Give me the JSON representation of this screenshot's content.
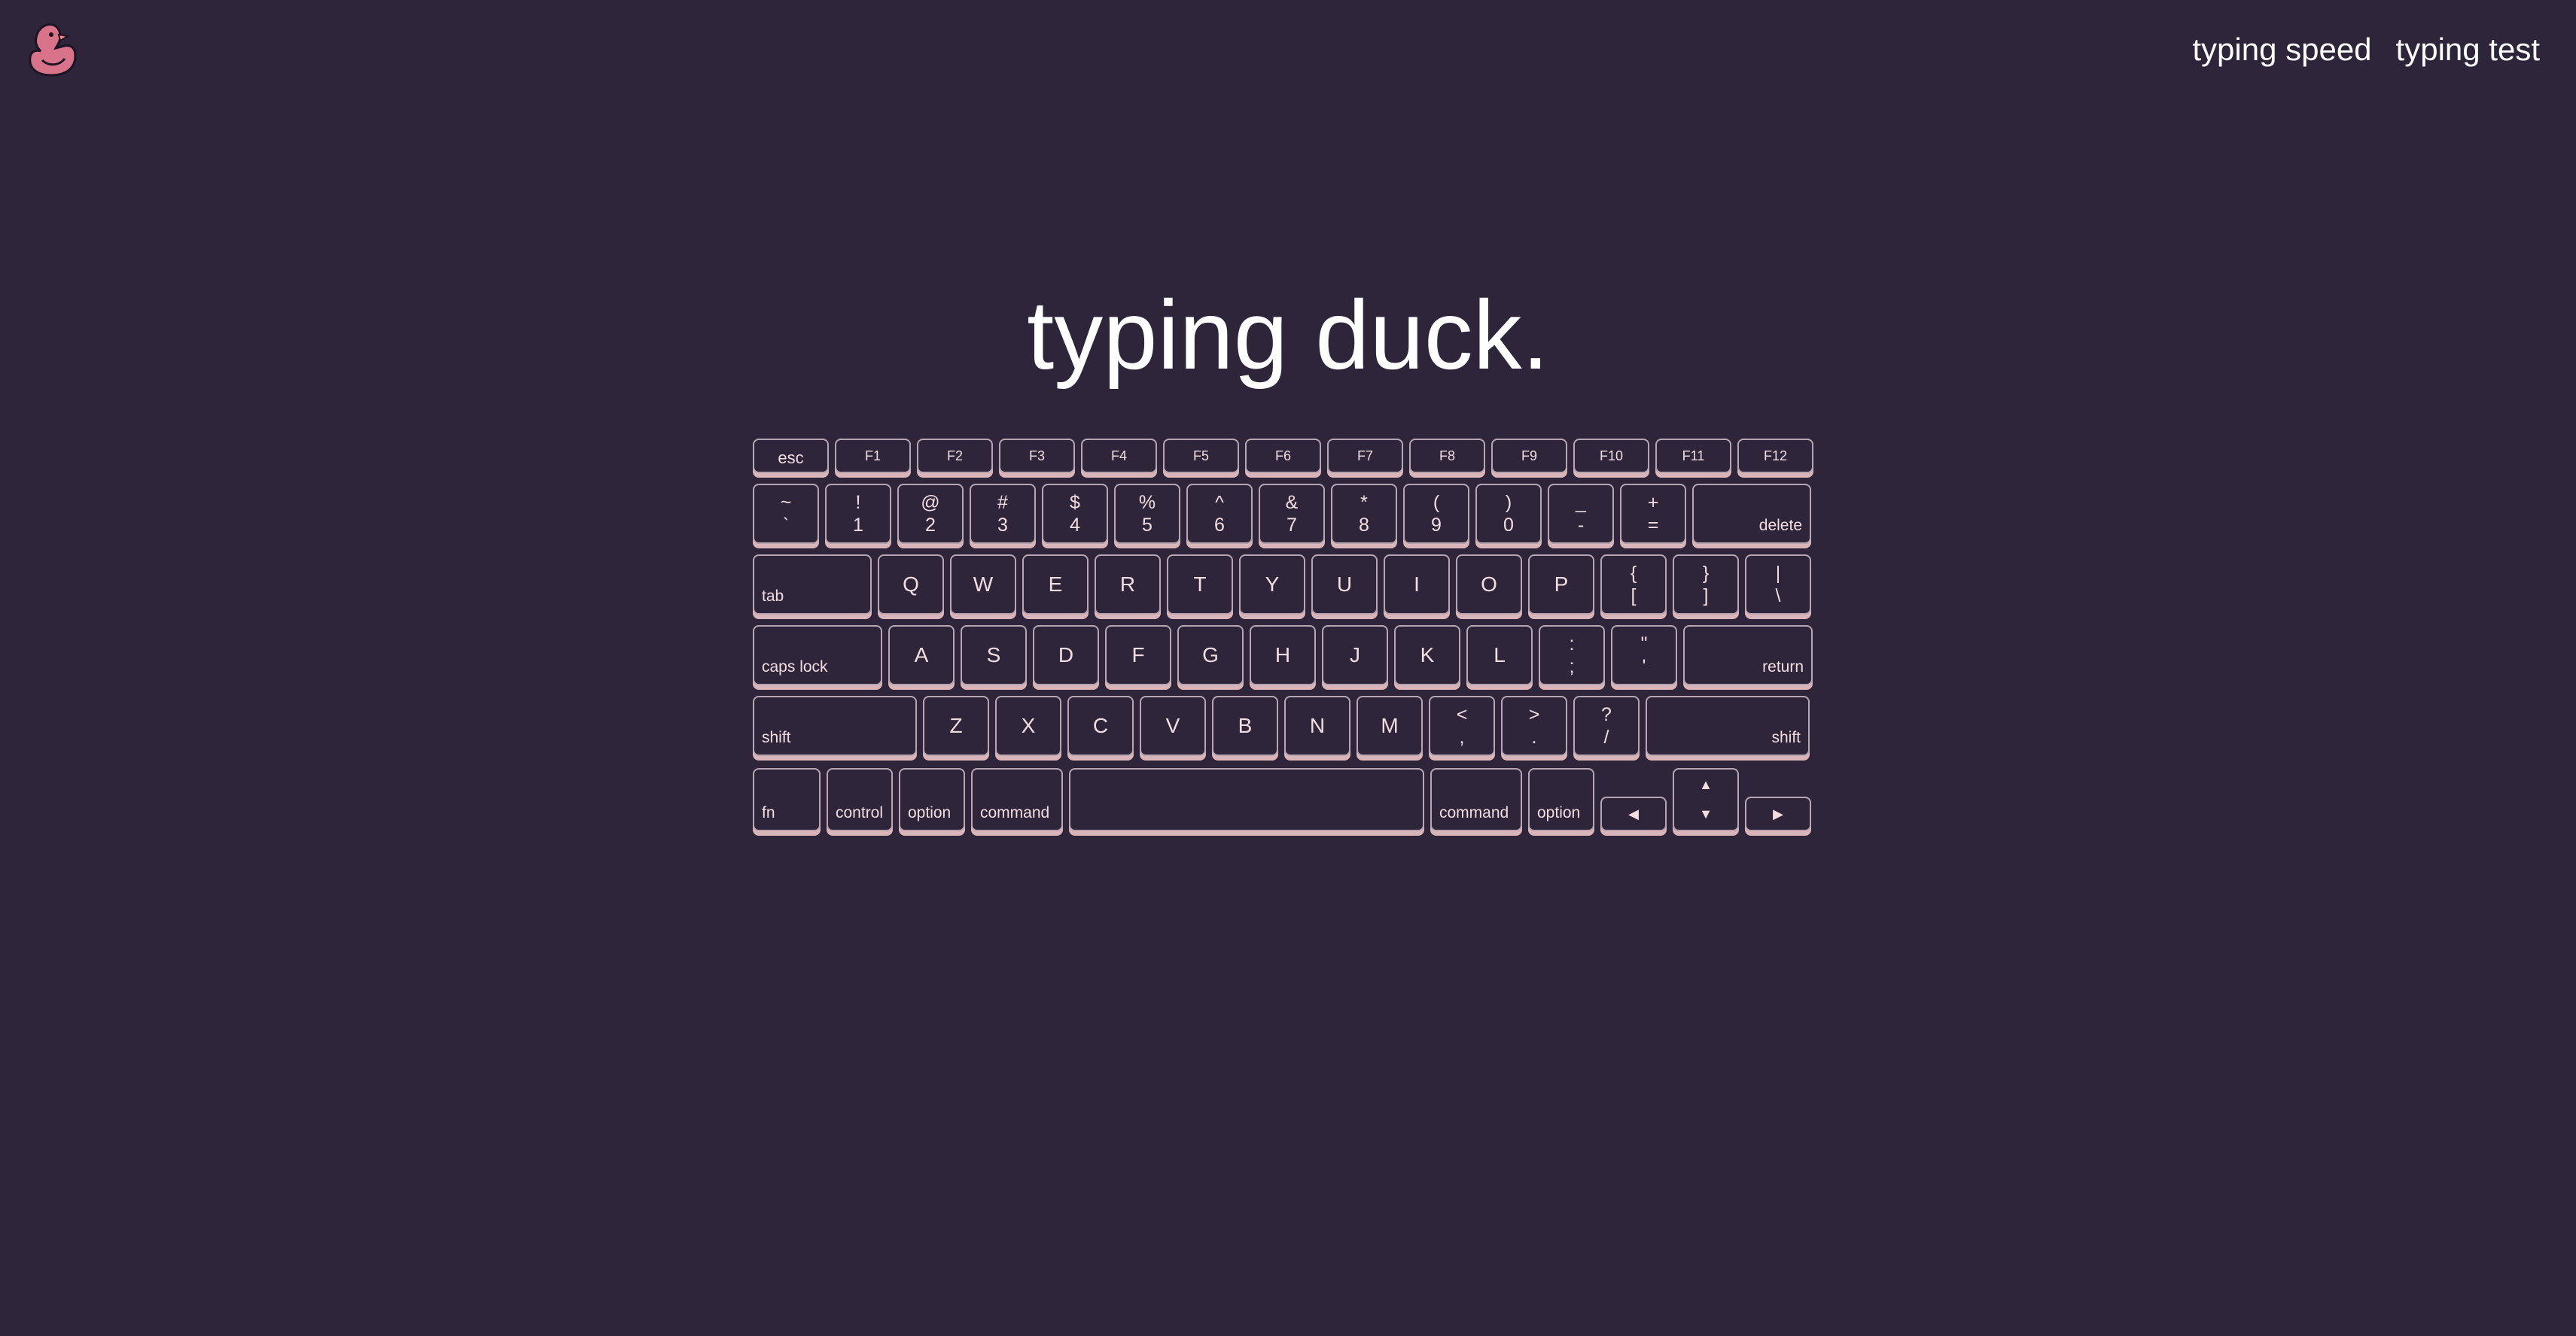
{
  "nav": {
    "speed": "typing speed",
    "test": "typing test"
  },
  "title": "typing duck.",
  "colors": {
    "background": "#2e253a",
    "key_border": "#b7a6b2",
    "key_shadow": "#d9b4b8",
    "key_text": "#f3dde0",
    "duck": "#d9738a"
  },
  "keyboard": {
    "fn_row": [
      "esc",
      "F1",
      "F2",
      "F3",
      "F4",
      "F5",
      "F6",
      "F7",
      "F8",
      "F9",
      "F10",
      "F11",
      "F12"
    ],
    "num_row": [
      {
        "top": "~",
        "bottom": "`"
      },
      {
        "top": "!",
        "bottom": "1"
      },
      {
        "top": "@",
        "bottom": "2"
      },
      {
        "top": "#",
        "bottom": "3"
      },
      {
        "top": "$",
        "bottom": "4"
      },
      {
        "top": "%",
        "bottom": "5"
      },
      {
        "top": "^",
        "bottom": "6"
      },
      {
        "top": "&",
        "bottom": "7"
      },
      {
        "top": "*",
        "bottom": "8"
      },
      {
        "top": "(",
        "bottom": "9"
      },
      {
        "top": ")",
        "bottom": "0"
      },
      {
        "top": "_",
        "bottom": "-"
      },
      {
        "top": "+",
        "bottom": "="
      }
    ],
    "delete": "delete",
    "tab": "tab",
    "qwerty": [
      "Q",
      "W",
      "E",
      "R",
      "T",
      "Y",
      "U",
      "I",
      "O",
      "P"
    ],
    "brackets": [
      {
        "top": "{",
        "bottom": "["
      },
      {
        "top": "}",
        "bottom": "]"
      },
      {
        "top": "|",
        "bottom": "\\"
      }
    ],
    "caps_lock": "caps lock",
    "home": [
      "A",
      "S",
      "D",
      "F",
      "G",
      "H",
      "J",
      "K",
      "L"
    ],
    "home_punct": [
      {
        "top": ":",
        "bottom": ";"
      },
      {
        "top": "\"",
        "bottom": "'"
      }
    ],
    "return": "return",
    "shift": "shift",
    "bottom_letters": [
      "Z",
      "X",
      "C",
      "V",
      "B",
      "N",
      "M"
    ],
    "bottom_punct": [
      {
        "top": "<",
        "bottom": ","
      },
      {
        "top": ">",
        "bottom": "."
      },
      {
        "top": "?",
        "bottom": "/"
      }
    ],
    "mods": {
      "fn": "fn",
      "control": "control",
      "option": "option",
      "command": "command"
    },
    "arrows": {
      "left": "◀",
      "up": "▲",
      "down": "▼",
      "right": "▶"
    }
  }
}
